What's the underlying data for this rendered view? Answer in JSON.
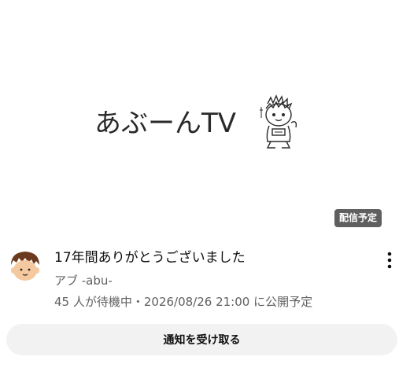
{
  "thumbnail": {
    "logo_text": "あぶーんTV",
    "badge": "配信予定"
  },
  "video": {
    "title": "17年間ありがとうございました",
    "channel": "アブ -abu-",
    "meta": "45 人が待機中・2026/08/26 21:00 に公開予定"
  },
  "actions": {
    "notify_label": "通知を受け取る",
    "more_icon": "more-vert-icon"
  },
  "colors": {
    "badge_bg": "#5f5f5f",
    "secondary_text": "#606060",
    "button_bg": "#f2f2f2"
  }
}
